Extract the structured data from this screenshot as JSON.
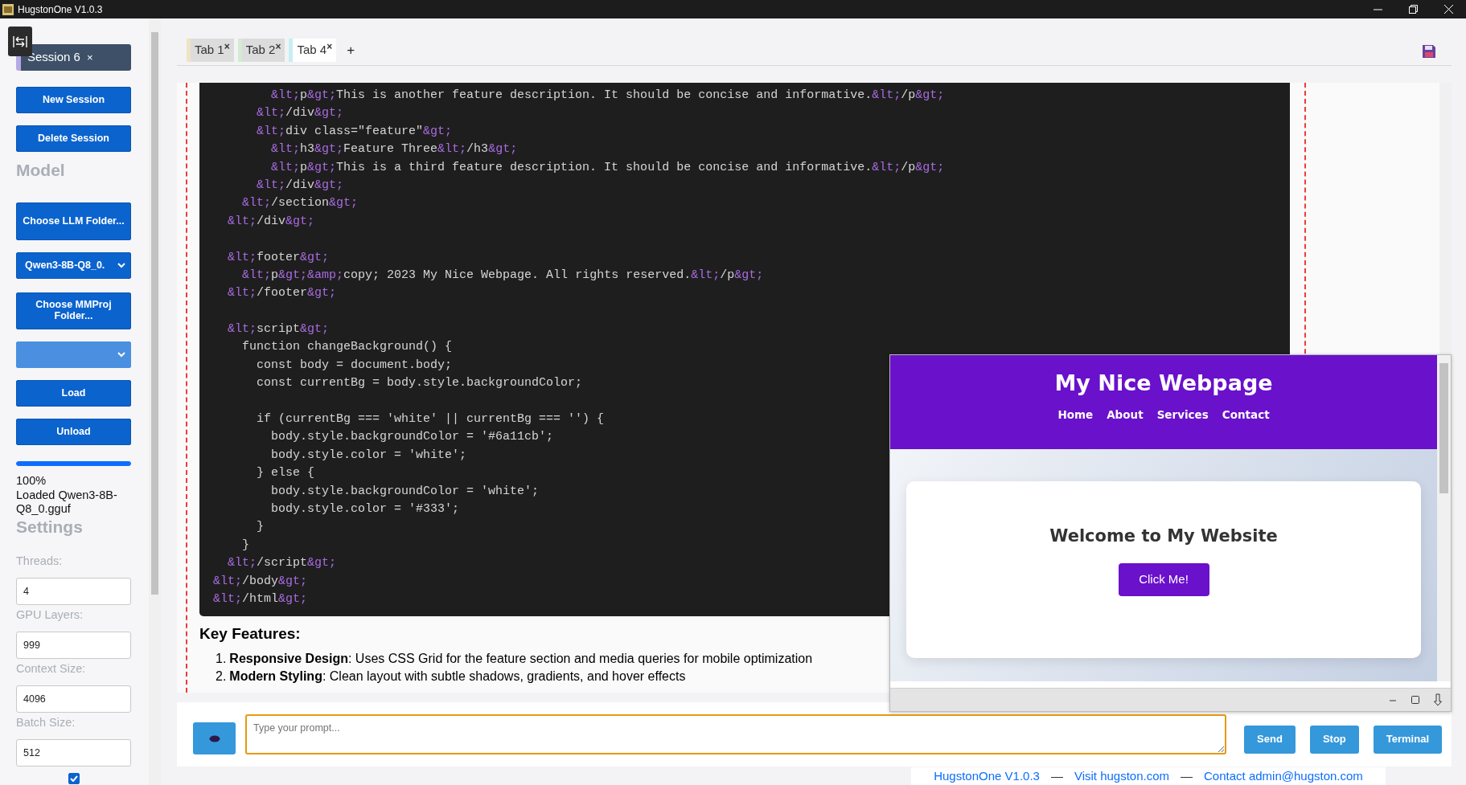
{
  "window": {
    "title": "HugstonOne V1.0.3"
  },
  "sidebar": {
    "session_tab": {
      "label": "Session 6",
      "close": "×"
    },
    "items": [
      {
        "kind": "button",
        "label": "New Session"
      },
      {
        "kind": "button",
        "label": "Delete Session"
      },
      {
        "kind": "heading",
        "label": "Model"
      },
      {
        "kind": "button",
        "label": "Choose LLM Folder..."
      },
      {
        "kind": "select",
        "value": "Qwen3-8B-Q8_0.",
        "disabled": false
      },
      {
        "kind": "button",
        "label": "Choose MMProj Folder..."
      },
      {
        "kind": "select",
        "disabled": true
      },
      {
        "kind": "button",
        "label": "Load"
      },
      {
        "kind": "button",
        "label": "Unload"
      },
      {
        "kind": "progress",
        "level": 1
      },
      {
        "kind": "text",
        "label": "100%"
      },
      {
        "kind": "text",
        "label": "Loaded Qwen3-8B-Q8_0.gguf"
      },
      {
        "kind": "heading",
        "label": "Settings"
      },
      {
        "kind": "field",
        "label": "Threads:",
        "value": "4"
      },
      {
        "kind": "field",
        "label": "GPU Layers:",
        "value": "999"
      },
      {
        "kind": "field",
        "label": "Context Size:",
        "value": "4096"
      },
      {
        "kind": "field",
        "label": "Batch Size:",
        "value": "512"
      },
      {
        "kind": "checkbox",
        "checked": true
      }
    ]
  },
  "tabs": [
    {
      "label": "Tab 1",
      "close": "×",
      "color": "#efe3c4",
      "selected": false
    },
    {
      "label": "Tab 2",
      "close": "×",
      "color": "#d3ead3",
      "selected": false
    },
    {
      "label": "Tab 4",
      "close": "×",
      "color": "#c6eff4",
      "selected": true
    }
  ],
  "add_tab": "+",
  "code_lines": [
    {
      "kind": "code",
      "text": "        &lt;p&gt;This is another feature description. It should be concise and informative.&lt;/p&gt;"
    },
    {
      "kind": "code",
      "text": "      &lt;/div&gt;"
    },
    {
      "kind": "code",
      "text": "      &lt;div class=\"feature\"&gt;"
    },
    {
      "kind": "code",
      "text": "        &lt;h3&gt;Feature Three&lt;/h3&gt;"
    },
    {
      "kind": "code",
      "text": "        &lt;p&gt;This is a third feature description. It should be concise and informative.&lt;/p&gt;"
    },
    {
      "kind": "code",
      "text": "      &lt;/div&gt;"
    },
    {
      "kind": "code",
      "text": "    &lt;/section&gt;"
    },
    {
      "kind": "code",
      "text": "  &lt;/div&gt;"
    },
    {
      "kind": "blank"
    },
    {
      "kind": "code",
      "text": "  &lt;footer&gt;"
    },
    {
      "kind": "code",
      "text": "    &lt;p&gt;&amp;copy; 2023 My Nice Webpage. All rights reserved.&lt;/p&gt;"
    },
    {
      "kind": "code",
      "text": "  &lt;/footer&gt;"
    },
    {
      "kind": "blank"
    },
    {
      "kind": "code",
      "text": "  &lt;script&gt;"
    },
    {
      "kind": "code",
      "text": "    function changeBackground() {"
    },
    {
      "kind": "code",
      "text": "      const body = document.body;"
    },
    {
      "kind": "code",
      "text": "      const currentBg = body.style.backgroundColor;"
    },
    {
      "kind": "blank"
    },
    {
      "kind": "code",
      "text": "      if (currentBg === 'white' || currentBg === '') {"
    },
    {
      "kind": "code",
      "text": "        body.style.backgroundColor = '#6a11cb';"
    },
    {
      "kind": "code",
      "text": "        body.style.color = 'white';"
    },
    {
      "kind": "code",
      "text": "      } else {"
    },
    {
      "kind": "code",
      "text": "        body.style.backgroundColor = 'white';"
    },
    {
      "kind": "code",
      "text": "        body.style.color = '#333';"
    },
    {
      "kind": "code",
      "text": "      }"
    },
    {
      "kind": "code",
      "text": "    }"
    },
    {
      "kind": "code",
      "text": "  &lt;/script&gt;"
    },
    {
      "kind": "code",
      "text": "&lt;/body&gt;"
    },
    {
      "kind": "code",
      "text": "&lt;/html&gt;"
    }
  ],
  "key_features": {
    "title": "Key Features:",
    "items": [
      {
        "marker": "1.",
        "text": "**Responsive Design**: Uses CSS Grid for the feature section and media queries for mobile optimization"
      },
      {
        "marker": "2.",
        "text": "**Modern Styling**: Clean layout with subtle shadows, gradients, and hover effects"
      }
    ]
  },
  "preview": {
    "title": "My Nice Webpage",
    "nav": [
      "Home",
      "About",
      "Services",
      "Contact"
    ],
    "heading": "Welcome to My Website",
    "button": "Click Me!"
  },
  "prompt": {
    "placeholder": "Type your prompt..."
  },
  "actions": [
    "Send",
    "Stop",
    "Terminal"
  ],
  "footer": [
    {
      "kind": "link",
      "label": "HugstonOne V1.0.3"
    },
    {
      "kind": "separator",
      "label": "—"
    },
    {
      "kind": "link",
      "label": "Visit hugston.com"
    },
    {
      "kind": "separator",
      "label": "—"
    },
    {
      "kind": "link",
      "label": "Contact admin@hugston.com"
    }
  ]
}
